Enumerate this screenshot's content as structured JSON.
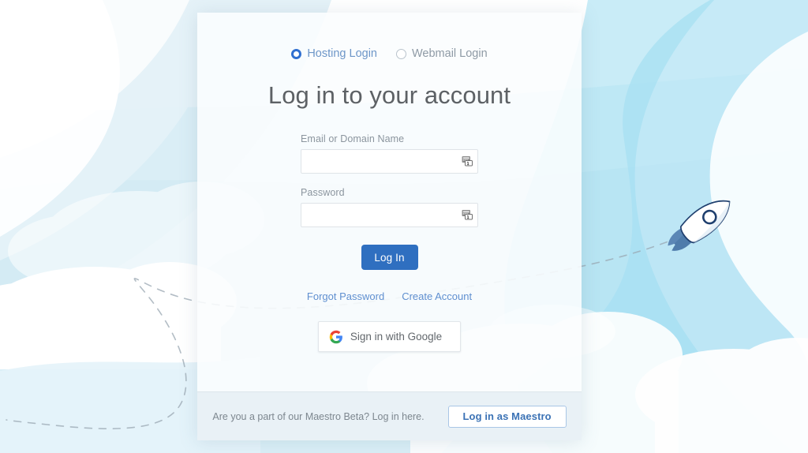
{
  "login_type": {
    "options": [
      {
        "label": "Hosting Login",
        "selected": true,
        "icon": "radio-selected-icon"
      },
      {
        "label": "Webmail Login",
        "selected": false,
        "icon": "radio-unselected-icon"
      }
    ]
  },
  "heading": "Log in to your account",
  "form": {
    "fields": [
      {
        "label": "Email or Domain Name",
        "value": "",
        "placeholder": "",
        "icon": "autofill-icon"
      },
      {
        "label": "Password",
        "value": "",
        "placeholder": "",
        "icon": "autofill-icon"
      }
    ],
    "submit_label": "Log In"
  },
  "links": [
    {
      "label": "Forgot Password"
    },
    {
      "label": "Create Account"
    }
  ],
  "google_button": {
    "label": "Sign in with Google",
    "icon": "google-g-icon"
  },
  "footer": {
    "text": "Are you a part of our Maestro Beta? Log in here.",
    "button_label": "Log in as Maestro"
  },
  "artwork": {
    "rocket": "rocket-icon",
    "clouds": "cloud-shapes",
    "flight_path": "dashed-flight-path"
  },
  "colors": {
    "primary_button": "#2f6fc0",
    "link": "#5f8fd0",
    "radio_selected": "#2f6fd0",
    "heading": "#5d6165",
    "label": "#8b959e",
    "maestro_border": "#a9c6e6",
    "maestro_text": "#3b72b5",
    "sky_blue": "#a8dff0",
    "sky_blue_pale": "#d9f0f8",
    "cloud_white": "#ffffff",
    "rocket_navy": "#1f3f6e",
    "rocket_fin": "#4d7fb0",
    "page_background": "#ffffff"
  }
}
